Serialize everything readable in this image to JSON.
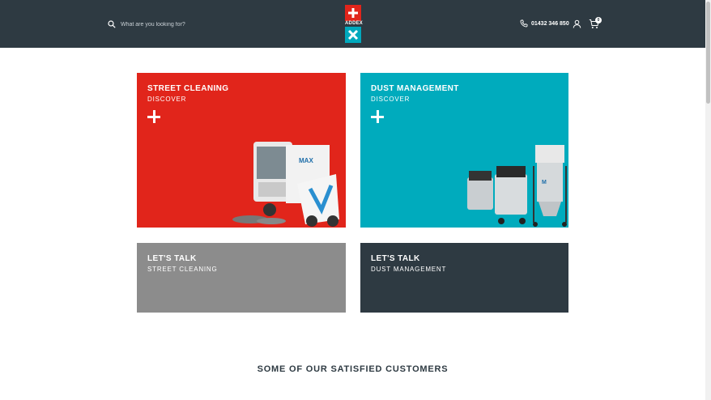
{
  "header": {
    "search_placeholder": "What are you looking for?",
    "logo_text": "ADDEX",
    "phone": "01432 346 850",
    "cart_count": "0"
  },
  "tiles": [
    {
      "title": "STREET CLEANING",
      "subtitle": "DISCOVER",
      "color": "#e1251b"
    },
    {
      "title": "DUST MANAGEMENT",
      "subtitle": "DISCOVER",
      "color": "#00abbd"
    },
    {
      "title": "LET'S TALK",
      "subtitle": "STREET CLEANING",
      "color": "#8c8c8c"
    },
    {
      "title": "LET'S TALK",
      "subtitle": "DUST MANAGEMENT",
      "color": "#2e3a42"
    }
  ],
  "customers_heading": "SOME OF OUR SATISFIED CUSTOMERS",
  "colors": {
    "header_bg": "#2e3a42",
    "brand_red": "#e1251b",
    "brand_teal": "#00a9bd"
  }
}
